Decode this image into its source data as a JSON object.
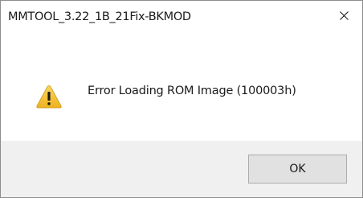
{
  "window": {
    "title": "MMTOOL_3.22_1B_21Fix-BKMOD",
    "close_icon": "close-icon"
  },
  "dialog": {
    "icon": "warning-icon",
    "message": "Error Loading ROM Image (100003h)"
  },
  "buttons": {
    "ok_label": "OK"
  },
  "colors": {
    "warning_fill": "#f7c53c",
    "warning_mark": "#000000",
    "footer_bg": "#f0f0f0",
    "button_bg": "#e1e1e1"
  }
}
